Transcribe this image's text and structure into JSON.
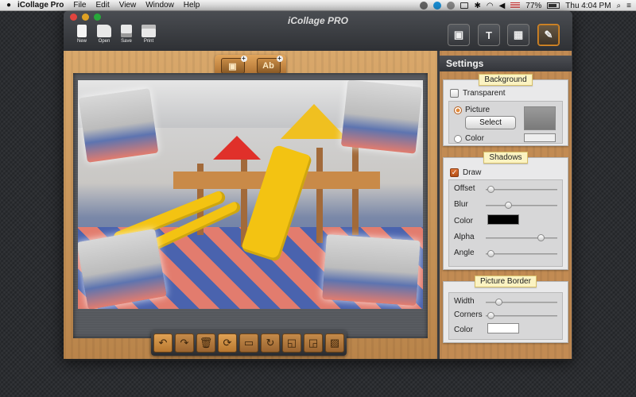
{
  "menubar": {
    "app_name": "iCollage Pro",
    "items": [
      "File",
      "Edit",
      "View",
      "Window",
      "Help"
    ],
    "battery": "77%",
    "clock": "Thu 4:04 PM"
  },
  "window": {
    "title": "iCollage PRO",
    "toolbar": [
      {
        "label": "New",
        "icon": "document-icon"
      },
      {
        "label": "Open",
        "icon": "folder-icon"
      },
      {
        "label": "Save",
        "icon": "save-icon"
      },
      {
        "label": "Print",
        "icon": "printer-icon"
      }
    ],
    "modes": [
      {
        "name": "pictures",
        "glyph": "▣"
      },
      {
        "name": "text",
        "glyph": "T"
      },
      {
        "name": "layout",
        "glyph": "▦"
      },
      {
        "name": "tools",
        "glyph": "✎"
      }
    ],
    "add_picture_glyph": "▣",
    "add_text_glyph": "Ab"
  },
  "bottom_tools": [
    {
      "name": "undo",
      "glyph": "↶"
    },
    {
      "name": "redo",
      "glyph": "↷"
    },
    {
      "name": "delete",
      "glyph": "🗑"
    },
    {
      "name": "shuffle",
      "glyph": "⟳"
    },
    {
      "name": "fit",
      "glyph": "▭"
    },
    {
      "name": "rotate",
      "glyph": "↻"
    },
    {
      "name": "bring-forward",
      "glyph": "◱"
    },
    {
      "name": "send-backward",
      "glyph": "◲"
    },
    {
      "name": "texture",
      "glyph": "▨"
    }
  ],
  "settings": {
    "title": "Settings",
    "background": {
      "header": "Background",
      "transparent_label": "Transparent",
      "transparent_checked": false,
      "picture_label": "Picture",
      "select_button": "Select",
      "color_label": "Color",
      "selected_option": "Picture"
    },
    "shadows": {
      "header": "Shadows",
      "draw_label": "Draw",
      "draw_checked": true,
      "offset_label": "Offset",
      "blur_label": "Blur",
      "color_label": "Color",
      "alpha_label": "Alpha",
      "angle_label": "Angle",
      "offset_value": 0.02,
      "blur_value": 0.3,
      "alpha_value": 0.8,
      "angle_value": 0.02,
      "color": "#000000"
    },
    "picture_border": {
      "header": "Picture Border",
      "width_label": "Width",
      "corners_label": "Corners",
      "color_label": "Color",
      "width_value": 0.15,
      "corners_value": 0.02,
      "color": "#ffffff"
    }
  },
  "colors": {
    "accent": "#d98a2a",
    "wood": "#c9955a",
    "slide_yellow": "#f3c312"
  }
}
